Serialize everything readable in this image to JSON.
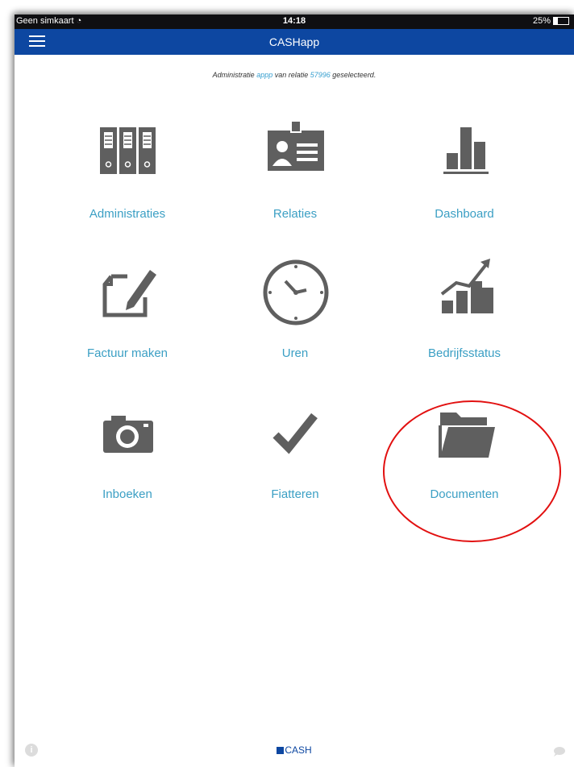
{
  "statusbar": {
    "carrier": "Geen simkaart",
    "time": "14:18",
    "battery": "25%",
    "battery_level": 0.25
  },
  "navbar": {
    "title": "CASHapp"
  },
  "subtitle": {
    "prefix": "Administratie ",
    "admin": "appp",
    "middle": " van relatie ",
    "relation": "57996",
    "suffix": " geselecteerd."
  },
  "tiles": [
    {
      "label": "Administraties",
      "icon": "binders-icon"
    },
    {
      "label": "Relaties",
      "icon": "id-card-icon"
    },
    {
      "label": "Dashboard",
      "icon": "bar-chart-icon"
    },
    {
      "label": "Factuur maken",
      "icon": "edit-document-icon"
    },
    {
      "label": "Uren",
      "icon": "clock-icon"
    },
    {
      "label": "Bedrijfsstatus",
      "icon": "trend-chart-icon"
    },
    {
      "label": "Inboeken",
      "icon": "camera-icon"
    },
    {
      "label": "Fiatteren",
      "icon": "checkmark-icon"
    },
    {
      "label": "Documenten",
      "icon": "folder-icon"
    }
  ],
  "footer": {
    "brand": "CASH",
    "info_icon": "info-icon",
    "chat_icon": "chat-icon"
  },
  "colors": {
    "nav": "#0d47a1",
    "label": "#3b9fc4",
    "icon": "#5f5f5f",
    "highlight": "#e21010"
  }
}
